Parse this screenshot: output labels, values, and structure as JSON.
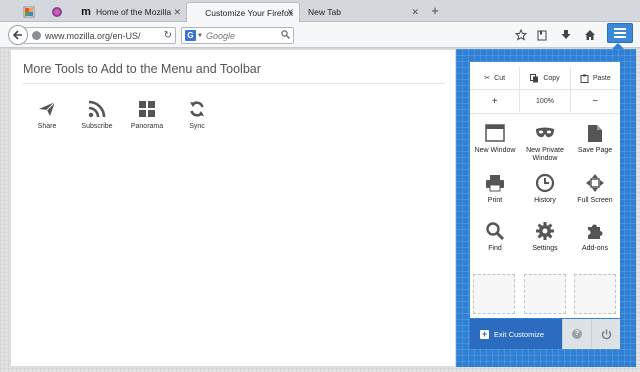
{
  "tabs": [
    {
      "title": "",
      "icon": "customize-icon"
    },
    {
      "title": "",
      "icon": "firefox-icon"
    },
    {
      "title": "Home of the Mozilla",
      "icon": "mozilla-icon"
    },
    {
      "title": "Customize Your Firefox",
      "icon": "customize-icon",
      "active": true
    },
    {
      "title": "New Tab",
      "icon": ""
    }
  ],
  "navbar": {
    "url": "www.mozilla.org/en-US/",
    "search_placeholder": "Google",
    "search_engine": "G"
  },
  "customize": {
    "heading": "More Tools to Add to the Menu and Toolbar",
    "tools": [
      {
        "label": "Share",
        "icon": "share-icon"
      },
      {
        "label": "Subscribe",
        "icon": "rss-icon"
      },
      {
        "label": "Panorama",
        "icon": "panorama-icon"
      },
      {
        "label": "Sync",
        "icon": "sync-icon"
      }
    ]
  },
  "panel": {
    "cut": "Cut",
    "copy": "Copy",
    "paste": "Paste",
    "zoom_out": "−",
    "zoom_level": "100%",
    "zoom_in": "+",
    "items": [
      {
        "label": "New Window",
        "icon": "window-icon"
      },
      {
        "label": "New Private Window",
        "icon": "mask-icon"
      },
      {
        "label": "Save Page",
        "icon": "page-icon"
      },
      {
        "label": "Print",
        "icon": "printer-icon"
      },
      {
        "label": "History",
        "icon": "clock-icon"
      },
      {
        "label": "Full Screen",
        "icon": "fullscreen-icon"
      },
      {
        "label": "Find",
        "icon": "magnifier-icon"
      },
      {
        "label": "Settings",
        "icon": "gear-icon"
      },
      {
        "label": "Add-ons",
        "icon": "puzzle-icon"
      }
    ],
    "exit_label": "Exit Customize",
    "help": "?"
  },
  "colors": {
    "accent": "#2f7fd5",
    "exit_button": "#2c6cc0"
  }
}
